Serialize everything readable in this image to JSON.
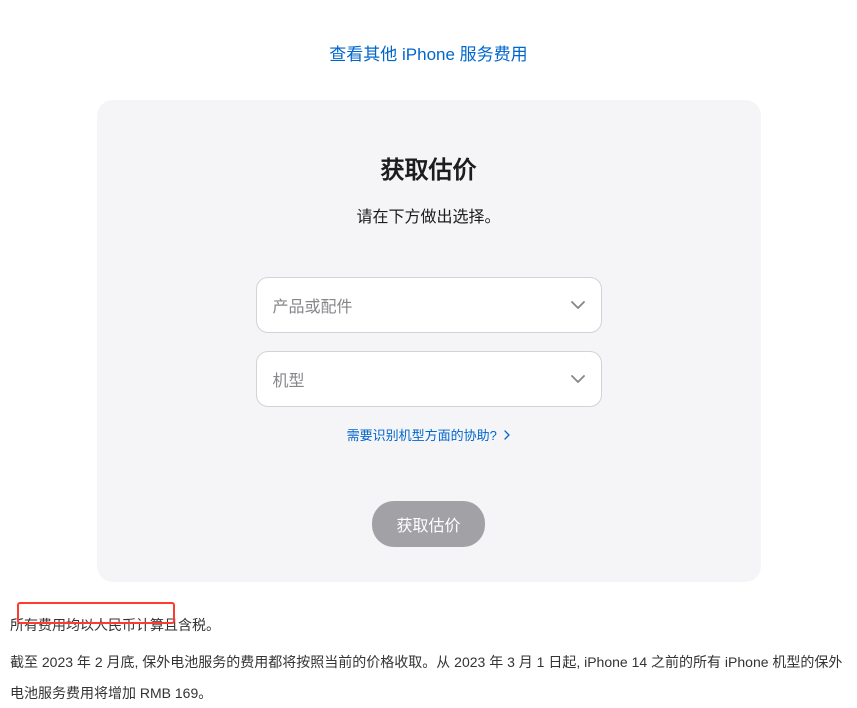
{
  "topLink": {
    "label": "查看其他 iPhone 服务费用"
  },
  "card": {
    "title": "获取估价",
    "subtitle": "请在下方做出选择。",
    "select1": {
      "placeholder": "产品或配件"
    },
    "select2": {
      "placeholder": "机型"
    },
    "helpLink": {
      "label": "需要识别机型方面的协助?"
    },
    "submitButton": {
      "label": "获取估价"
    }
  },
  "footer": {
    "line1": "所有费用均以人民币计算且含税。",
    "line2": "截至 2023 年 2 月底, 保外电池服务的费用都将按照当前的价格收取。从 2023 年 3 月 1 日起, iPhone 14 之前的所有 iPhone 机型的保外电池服务费用将增加 RMB 169。"
  }
}
